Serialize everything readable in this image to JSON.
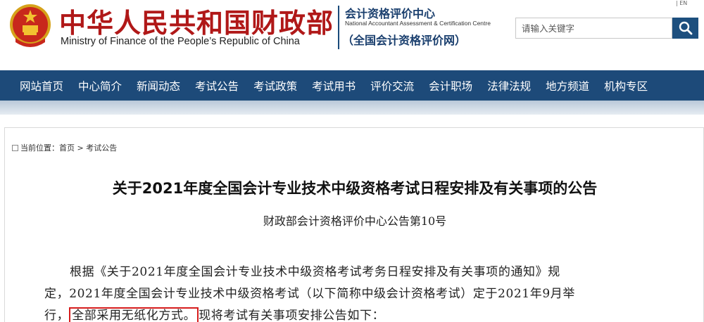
{
  "header": {
    "ministry_cn": "中华人民共和国财政部",
    "ministry_en": "Ministry of Finance of the People’s Republic of China",
    "center_cn": "会计资格评价中心",
    "center_en": "National Accountant Assessment & Certification Centre",
    "center_net": "（全国会计资格评价网）",
    "top_link": "| EN"
  },
  "search": {
    "placeholder": "请输入关键字"
  },
  "nav": {
    "items": [
      {
        "label": "网站首页"
      },
      {
        "label": "中心简介"
      },
      {
        "label": "新闻动态"
      },
      {
        "label": "考试公告"
      },
      {
        "label": "考试政策"
      },
      {
        "label": "考试用书"
      },
      {
        "label": "评价交流"
      },
      {
        "label": "会计职场"
      },
      {
        "label": "法律法规"
      },
      {
        "label": "地方频道"
      },
      {
        "label": "机构专区"
      }
    ]
  },
  "breadcrumb": {
    "prefix": "当前位置：",
    "home": "首页",
    "sep": " > ",
    "current": "考试公告"
  },
  "article": {
    "title": "关于2021年度全国会计专业技术中级资格考试日程安排及有关事项的公告",
    "subtitle": "财政部会计资格评价中心公告第10号",
    "line1": "根据《关于2021年度全国会计专业技术中级资格考试考务日程安排及有关事项的通知》规",
    "line2": "定，2021年度全国会计专业技术中级资格考试（以下简称中级会计资格考试）定于2021年9月举",
    "line3_start": "行，",
    "line3_highlight": "全部采用无纸化方式。",
    "line3_end": "现将考试有关事项安排公告如下："
  },
  "colors": {
    "brand_red": "#b01818",
    "nav_blue": "#1d4a79",
    "highlight_red": "#d61d1d"
  },
  "icons": {
    "emblem": "national-emblem-icon",
    "search": "search-icon",
    "breadcrumb": "location-icon"
  }
}
